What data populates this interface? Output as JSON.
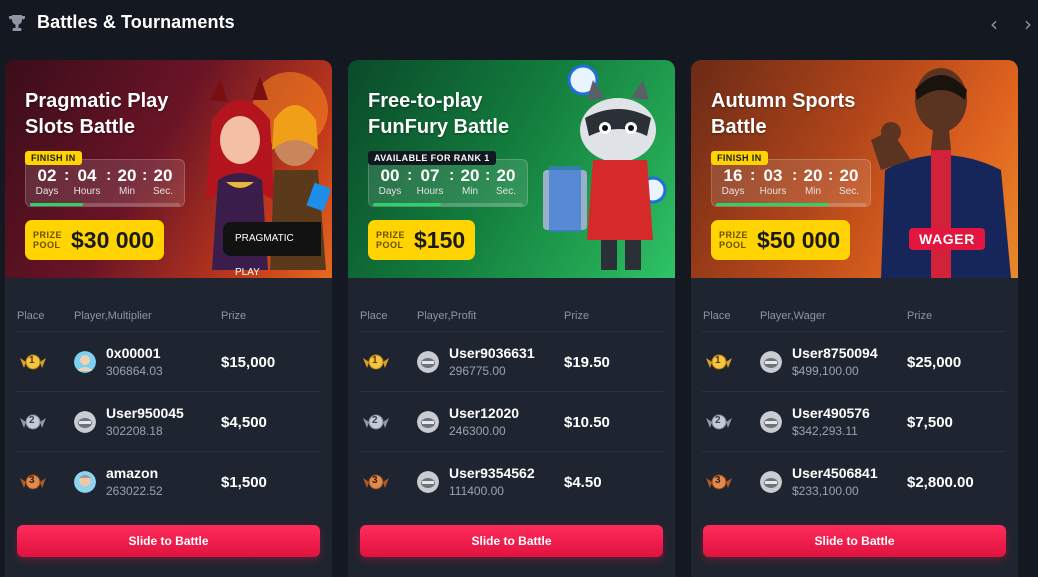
{
  "header": {
    "title": "Battles & Tournaments",
    "prev_icon": "chevron-left-icon",
    "next_icon": "chevron-right-icon",
    "prev_glyph": "‹",
    "next_glyph": "›"
  },
  "colors": {
    "page_bg": "#141821",
    "card_bg": "#1f2530",
    "accent_red": "#e0123e",
    "prize_yellow": "#ffd400",
    "progress_green": "#2cd36b"
  },
  "battles": [
    {
      "title_line1": "Pragmatic Play",
      "title_line2": "Slots Battle",
      "status": "FINISH IN",
      "timer": {
        "days": "02",
        "hours": "04",
        "min": "20",
        "sec": "20"
      },
      "timer_units": {
        "days": "Days",
        "hours": "Hours",
        "min": "Min",
        "sec": "Sec."
      },
      "progress": 0.35,
      "prize_label": "PRIZE POOL",
      "prize_amount": "$30 000",
      "badge": "PRAGMATIC PLAY",
      "columns": {
        "place": "Place",
        "player": "Player,Multiplier",
        "prize": "Prize"
      },
      "leaders": [
        {
          "place": "1",
          "name": "0x00001",
          "score": "306864.03",
          "prize": "$15,000"
        },
        {
          "place": "2",
          "name": "User950045",
          "score": "302208.18",
          "prize": "$4,500"
        },
        {
          "place": "3",
          "name": "amazon",
          "score": "263022.52",
          "prize": "$1,500"
        }
      ],
      "button": "Slide to Battle"
    },
    {
      "title_line1": "Free-to-play",
      "title_line2": "FunFury Battle",
      "status": "AVAILABLE FOR RANK 1",
      "timer": {
        "days": "00",
        "hours": "07",
        "min": "20",
        "sec": "20"
      },
      "timer_units": {
        "days": "Days",
        "hours": "Hours",
        "min": "Min",
        "sec": "Sec."
      },
      "progress": 0.45,
      "prize_label": "PRIZE POOL",
      "prize_amount": "$150",
      "columns": {
        "place": "Place",
        "player": "Player,Profit",
        "prize": "Prize"
      },
      "leaders": [
        {
          "place": "1",
          "name": "User9036631",
          "score": "296775.00",
          "prize": "$19.50"
        },
        {
          "place": "2",
          "name": "User12020",
          "score": "246300.00",
          "prize": "$10.50"
        },
        {
          "place": "3",
          "name": "User9354562",
          "score": "111400.00",
          "prize": "$4.50"
        }
      ],
      "button": "Slide to Battle"
    },
    {
      "title_line1": "Autumn Sports",
      "title_line2": "Battle",
      "status": "FINISH IN",
      "timer": {
        "days": "16",
        "hours": "03",
        "min": "20",
        "sec": "20"
      },
      "timer_units": {
        "days": "Days",
        "hours": "Hours",
        "min": "Min",
        "sec": "Sec."
      },
      "progress": 0.75,
      "prize_label": "PRIZE POOL",
      "prize_amount": "$50 000",
      "badge": "WAGER",
      "columns": {
        "place": "Place",
        "player": "Player,Wager",
        "prize": "Prize"
      },
      "leaders": [
        {
          "place": "1",
          "name": "User8750094",
          "score": "$499,100.00",
          "prize": "$25,000"
        },
        {
          "place": "2",
          "name": "User490576",
          "score": "$342,293.11",
          "prize": "$7,500"
        },
        {
          "place": "3",
          "name": "User4506841",
          "score": "$233,100.00",
          "prize": "$2,800.00"
        }
      ],
      "button": "Slide to Battle"
    }
  ]
}
